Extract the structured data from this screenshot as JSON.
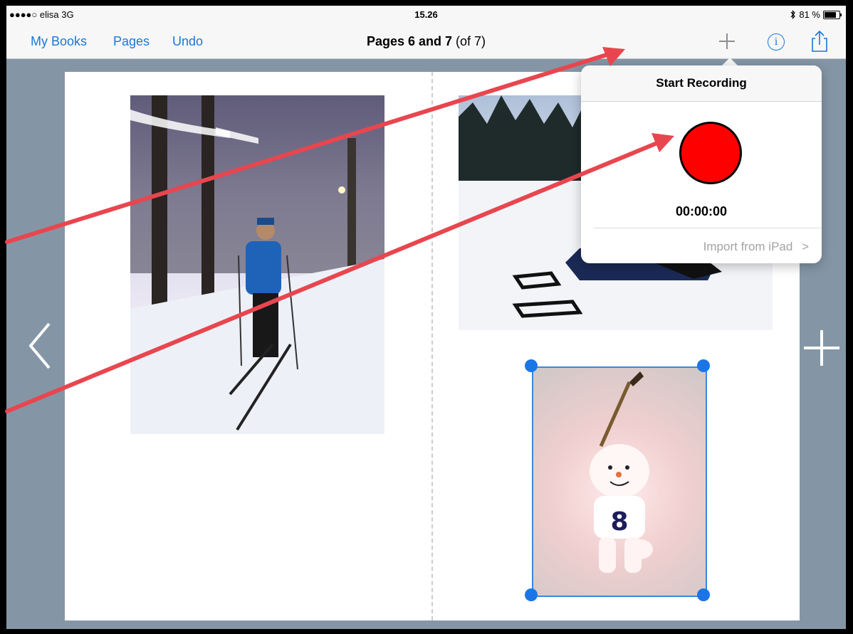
{
  "status_bar": {
    "carrier": "●●●●○ elisa  3G",
    "time": "15.26",
    "battery": "81 %"
  },
  "nav": {
    "my_books": "My Books",
    "pages": "Pages",
    "undo": "Undo",
    "title_bold": "Pages 6 and 7",
    "title_suffix": " (of 7)",
    "info_glyph": "i"
  },
  "popover": {
    "title": "Start Recording",
    "timer": "00:00:00",
    "import_label": "Import from iPad",
    "import_chevron": ">"
  },
  "colors": {
    "accent": "#1778d9",
    "record": "#ff0000",
    "annotation": "#e8464f",
    "selection": "#1c75e6"
  },
  "icons": [
    "add-icon",
    "info-icon",
    "share-icon",
    "chevron-left-icon",
    "add-page-icon",
    "bluetooth-icon",
    "battery-icon"
  ]
}
